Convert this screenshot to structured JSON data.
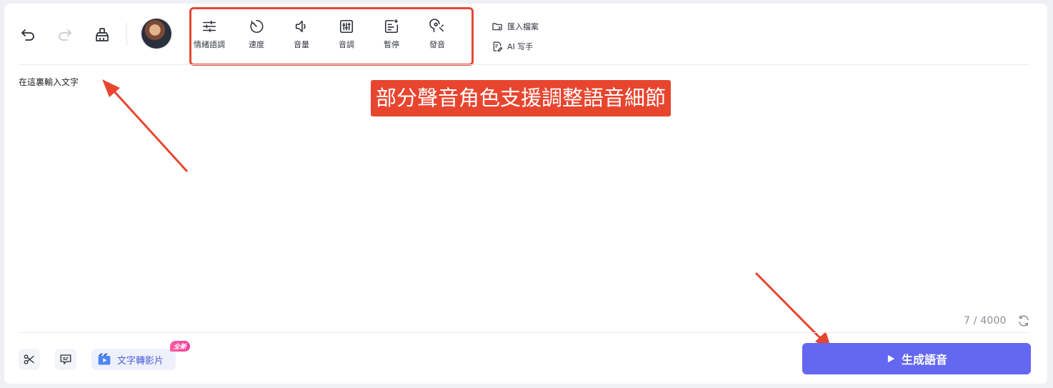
{
  "toolbar": {
    "tools": [
      {
        "label": "情緒語調",
        "icon": "sliders-icon"
      },
      {
        "label": "速度",
        "icon": "speed-icon"
      },
      {
        "label": "音量",
        "icon": "volume-icon"
      },
      {
        "label": "音調",
        "icon": "equalizer-icon"
      },
      {
        "label": "暫停",
        "icon": "pause-insert-icon"
      },
      {
        "label": "發音",
        "icon": "pronunciation-icon"
      }
    ],
    "import_label": "匯入檔案",
    "ai_write_label": "AI 写手"
  },
  "editor": {
    "text": "在這裏輸入文字",
    "counter": "7 / 4000"
  },
  "annotation": {
    "banner": "部分聲音角色支援調整語音細節",
    "accent": "#e8452f"
  },
  "bottom": {
    "text_to_video_label": "文字轉影片",
    "new_badge": "全新",
    "generate_label": "生成語音"
  },
  "colors": {
    "primary": "#6467f0",
    "badge_pink": "#f2389a"
  }
}
